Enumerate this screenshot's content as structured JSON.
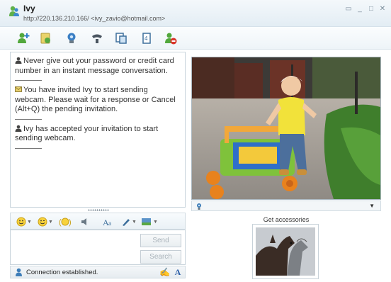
{
  "window": {
    "name": "Ivy",
    "subtitle": "http://220.136.210.166/ <ivy_zavio@hotmail.com>",
    "controls": [
      "restore",
      "minimize",
      "maximize",
      "close"
    ]
  },
  "toolbar": {
    "icons": [
      "invite-contact-icon",
      "send-files-icon",
      "webcam-icon",
      "voice-icon",
      "activities-icon",
      "games-icon",
      "block-icon"
    ]
  },
  "conversation": {
    "messages": [
      {
        "icon": "person-icon",
        "text": "Never give out your password or credit card number in an instant message conversation."
      },
      {
        "icon": "envelope-icon",
        "text": "You have invited Ivy to start sending webcam. Please wait for a response or Cancel (Alt+Q) the pending invitation."
      },
      {
        "icon": "person-icon",
        "text": "Ivy has accepted your invitation to start sending webcam."
      }
    ]
  },
  "format_toolbar": {
    "icons": [
      "emoticon-icon",
      "wink-icon",
      "nudge-icon",
      "voice-clip-icon",
      "font-icon",
      "pen-icon",
      "background-icon"
    ]
  },
  "compose": {
    "send_label": "Send",
    "search_label": "Search"
  },
  "status": {
    "text": "Connection established."
  },
  "video": {
    "dropdown_icon": "chevron-down-icon"
  },
  "accessories": {
    "label": "Get accessories"
  },
  "colors": {
    "titlebar": "#e9f1f7",
    "panel_border": "#c9d4dc",
    "accent_green": "#4a9a2f"
  }
}
